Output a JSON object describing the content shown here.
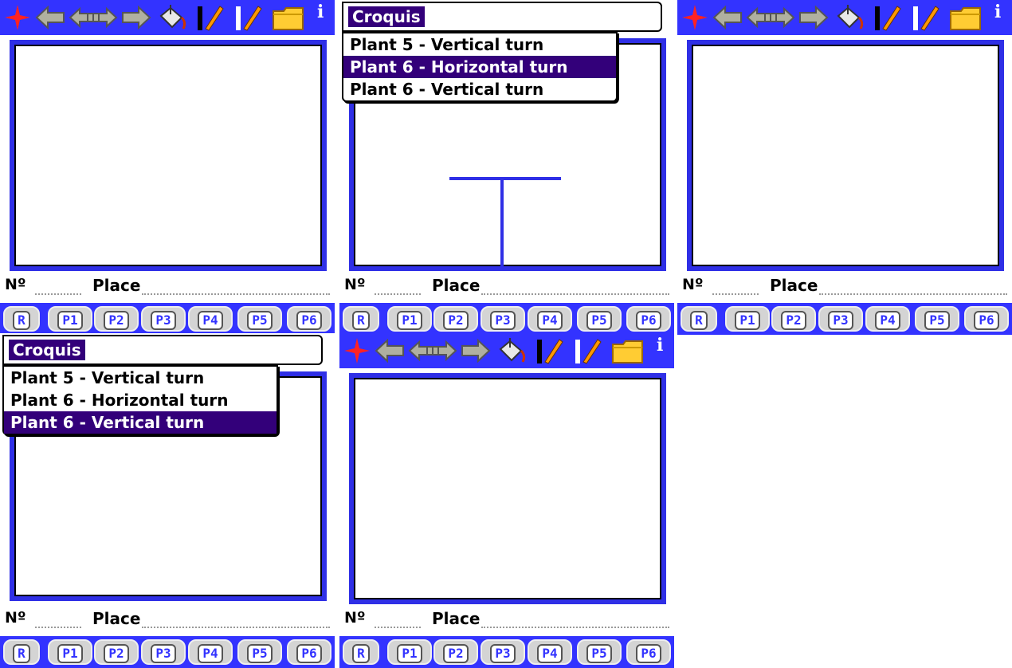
{
  "toolbar": {
    "icons": [
      "close-icon",
      "back-arrow-icon",
      "pan-arrows-icon",
      "forward-arrow-icon",
      "paint-bucket-icon",
      "pencil-black-icon",
      "pencil-white-icon",
      "folder-icon",
      "info-icon"
    ],
    "info_label": "i"
  },
  "menu": {
    "title": "Croquis",
    "items": [
      "Plant 5 - Vertical turn",
      "Plant 6 - Horizontal turn",
      "Plant 6 - Vertical turn"
    ]
  },
  "fields": {
    "number_label": "Nº",
    "place_label": "Place"
  },
  "tabs": [
    "R",
    "P1",
    "P2",
    "P3",
    "P4",
    "P5",
    "P6"
  ],
  "colors": {
    "frame": "#3333ff",
    "selection": "#33007a",
    "line": "#2f2fe6"
  },
  "screens": [
    {
      "id": "s1",
      "mode": "toolbar"
    },
    {
      "id": "s2",
      "mode": "menu",
      "selected_index": 1
    },
    {
      "id": "s3",
      "mode": "toolbar"
    },
    {
      "id": "s4",
      "mode": "menu",
      "selected_index": 2
    },
    {
      "id": "s5",
      "mode": "toolbar"
    }
  ]
}
